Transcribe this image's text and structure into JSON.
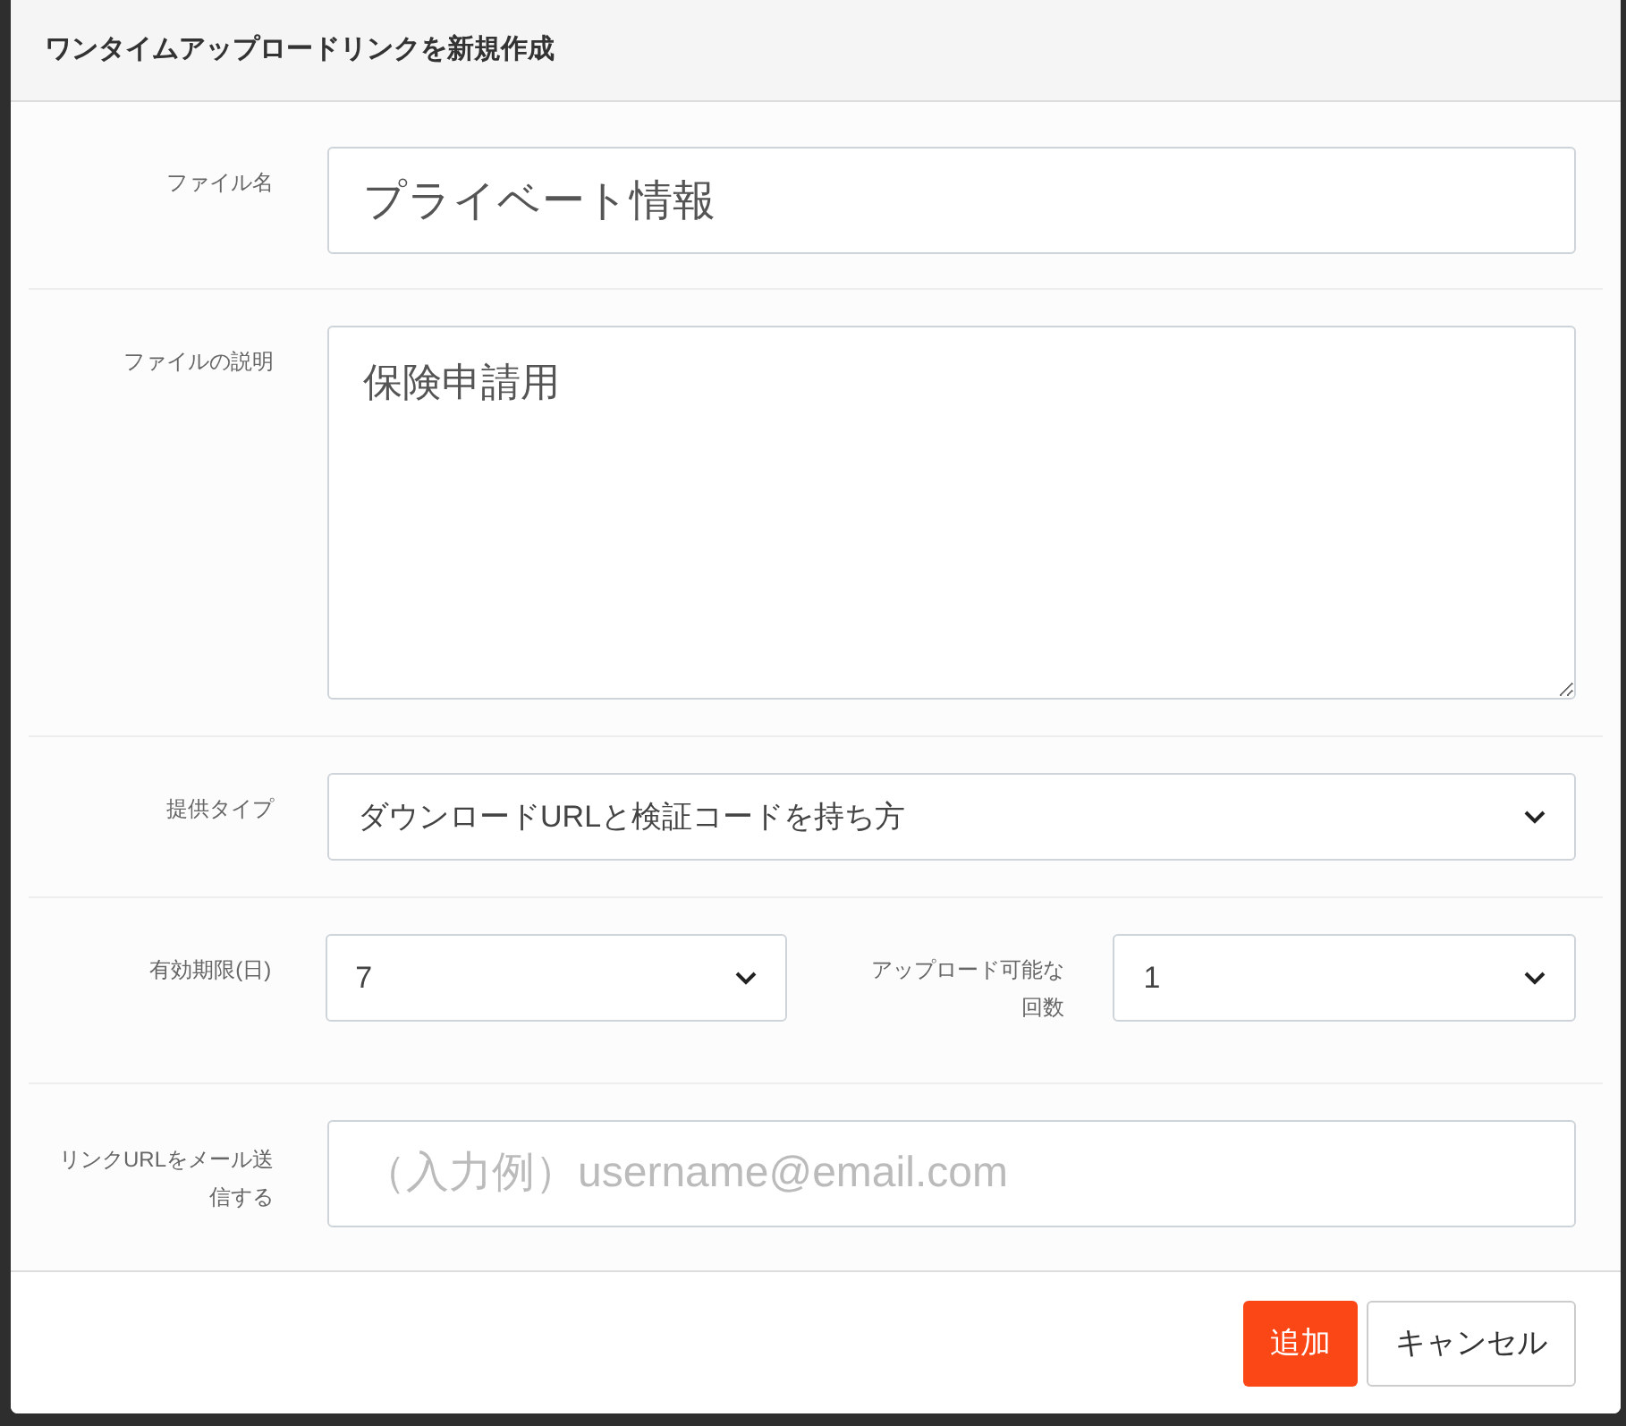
{
  "dialog": {
    "title": "ワンタイムアップロードリンクを新規作成"
  },
  "rows": [
    {
      "kind": "text",
      "label": "ファイル名",
      "value": "プライベート情報"
    },
    {
      "kind": "textarea",
      "label": "ファイルの説明",
      "value": "保険申請用"
    },
    {
      "kind": "select",
      "label": "提供タイプ",
      "value": "ダウンロードURLと検証コードを持ち方"
    },
    {
      "kind": "pair",
      "label": "有効期限(日)",
      "value": "7",
      "label_2": "アップロード可能な回数",
      "value_2": "1"
    },
    {
      "kind": "email",
      "label": "リンクURLをメール送信する",
      "placeholder": "（入力例）username@email.com"
    }
  ],
  "buttons": [
    {
      "kind": "primary",
      "label": "追加"
    },
    {
      "kind": "secondary",
      "label": "キャンセル"
    }
  ]
}
